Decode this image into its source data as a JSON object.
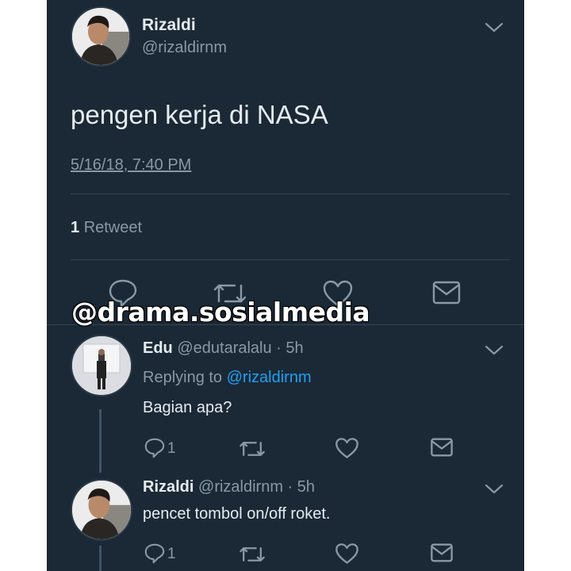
{
  "main_tweet": {
    "name": "Rizaldi",
    "handle": "@rizaldirnm",
    "text": "pengen kerja di NASA",
    "timestamp": "5/16/18, 7:40 PM",
    "retweet_count": "1",
    "retweet_label": "Retweet"
  },
  "watermark": "@drama.sosialmedia",
  "replies": [
    {
      "name": "Edu",
      "handle_time": "@edutaralalu · 5h",
      "replying_prefix": "Replying to",
      "replying_to": "@rizaldirnm",
      "text": "Bagian apa?",
      "reply_count": "1"
    },
    {
      "name": "Rizaldi",
      "handle_time": "@rizaldirnm · 5h",
      "text": "pencet tombol on/off roket.",
      "reply_count": "1"
    }
  ],
  "colors": {
    "background": "#1b2836",
    "primary_text": "#e6ecf0",
    "secondary_text": "#8899a6",
    "link": "#1da1f2",
    "divider": "#38444d"
  },
  "icons": [
    "chevron-down-icon",
    "reply-icon",
    "retweet-icon",
    "like-icon",
    "share-icon"
  ]
}
